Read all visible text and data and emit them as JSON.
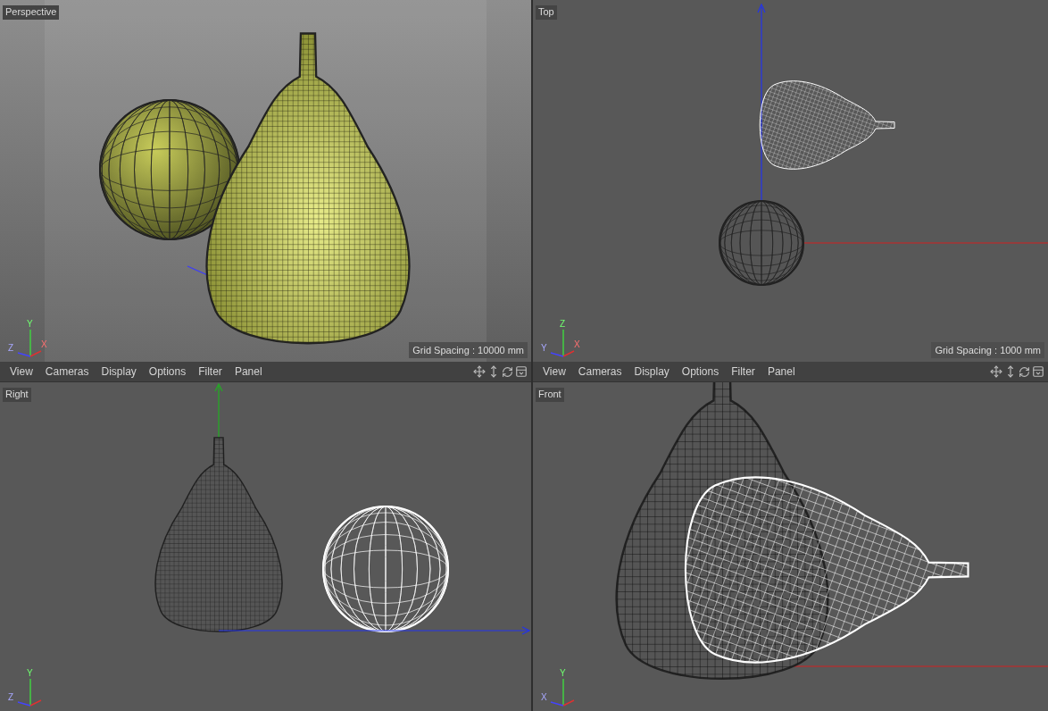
{
  "viewports": [
    {
      "kind": "perspective",
      "label": "Perspective",
      "grid_spacing": "Grid Spacing : 10000 mm",
      "axes": [
        "Y",
        "Z",
        "X"
      ]
    },
    {
      "kind": "top",
      "label": "Top",
      "grid_spacing": "Grid Spacing : 1000 mm",
      "axes": [
        "Z",
        "Y",
        "X"
      ]
    },
    {
      "kind": "right",
      "label": "Right",
      "menu": [
        "View",
        "Cameras",
        "Display",
        "Options",
        "Filter",
        "Panel"
      ],
      "axes": [
        "Y",
        "Z"
      ]
    },
    {
      "kind": "front",
      "label": "Front",
      "menu": [
        "View",
        "Cameras",
        "Display",
        "Options",
        "Filter",
        "Panel"
      ],
      "axes": [
        "Y",
        "X"
      ]
    }
  ]
}
